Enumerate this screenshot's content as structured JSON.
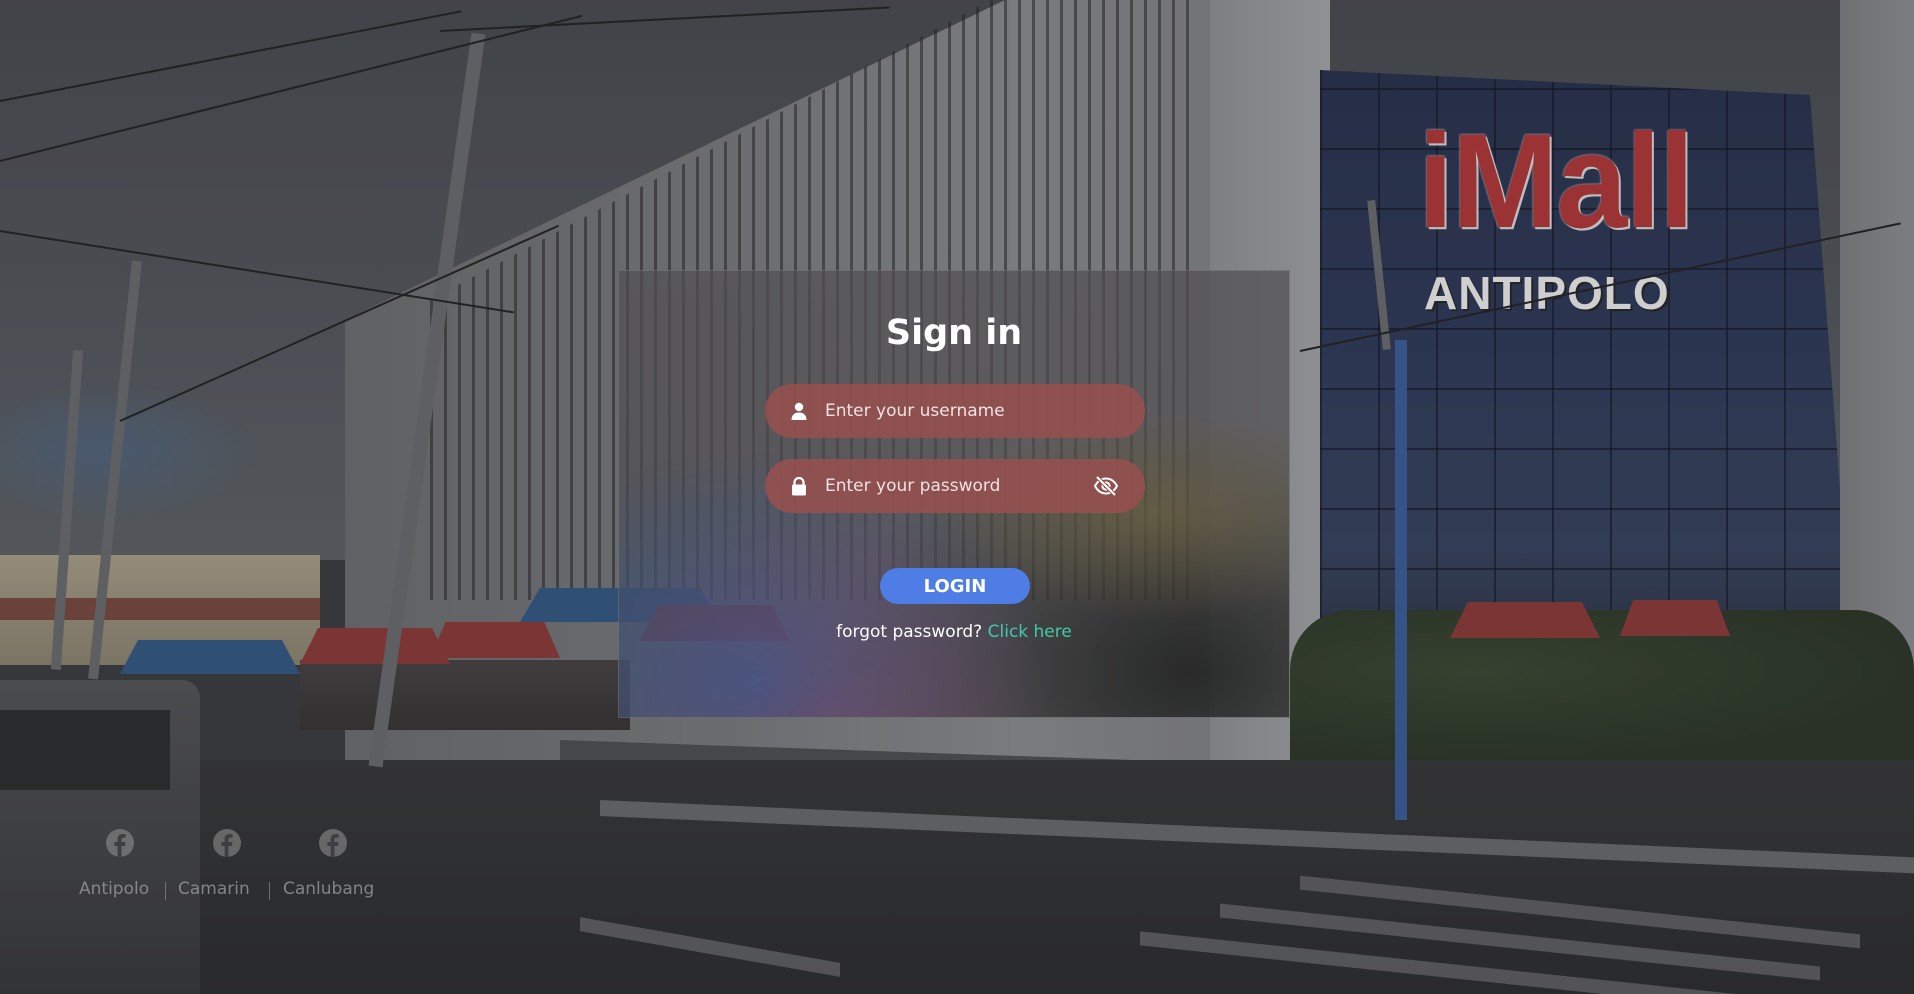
{
  "background": {
    "mall_logo_text": "iMall",
    "mall_subtitle": "ANTIPOLO"
  },
  "signin": {
    "title": "Sign in",
    "username_placeholder": "Enter your username",
    "password_placeholder": "Enter your password",
    "login_label": "LOGIN",
    "forgot_text": "forgot password?",
    "forgot_link": "Click here"
  },
  "footer": {
    "branches": [
      {
        "label": "Antipolo",
        "icon": "facebook-icon"
      },
      {
        "label": "Camarin",
        "icon": "facebook-icon"
      },
      {
        "label": "Canlubang",
        "icon": "facebook-icon"
      }
    ]
  },
  "colors": {
    "field_bg": "#965050",
    "login_button": "#4f7de6",
    "link": "#42c9a9"
  }
}
